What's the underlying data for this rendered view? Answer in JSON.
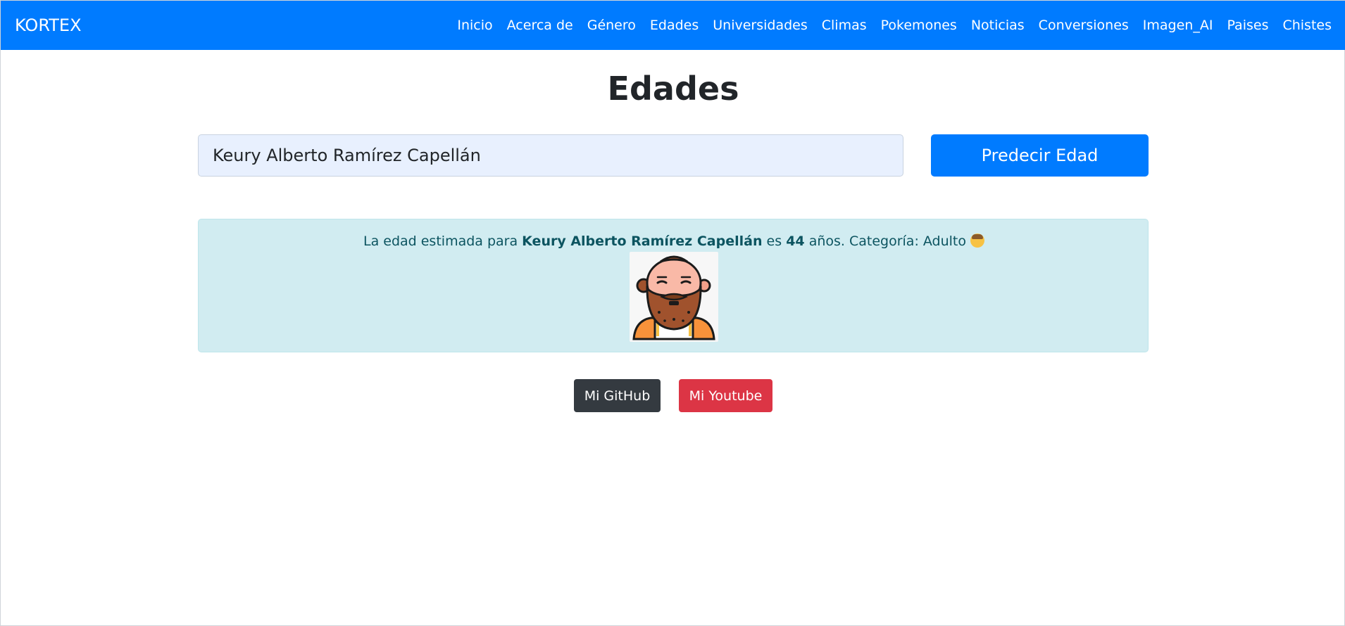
{
  "navbar": {
    "brand": "KORTEX",
    "links": [
      "Inicio",
      "Acerca de",
      "Género",
      "Edades",
      "Universidades",
      "Climas",
      "Pokemones",
      "Noticias",
      "Conversiones",
      "Imagen_AI",
      "Paises",
      "Chistes"
    ]
  },
  "page": {
    "title": "Edades"
  },
  "form": {
    "name_value": "Keury Alberto Ramírez Capellán",
    "submit_label": "Predecir Edad"
  },
  "result": {
    "prefix": "La edad estimada para",
    "name": "Keury Alberto Ramírez Capellán",
    "connector": "es",
    "age": "44",
    "suffix": "años. Categoría: Adulto",
    "category_icon": "adult-face-emoji"
  },
  "footer": {
    "github_label": "Mi GitHub",
    "youtube_label": "Mi Youtube"
  },
  "colors": {
    "primary": "#007bff",
    "alert_bg": "#d1ecf1",
    "alert_text": "#0c5460",
    "github": "#343a40",
    "youtube": "#dc3545"
  }
}
